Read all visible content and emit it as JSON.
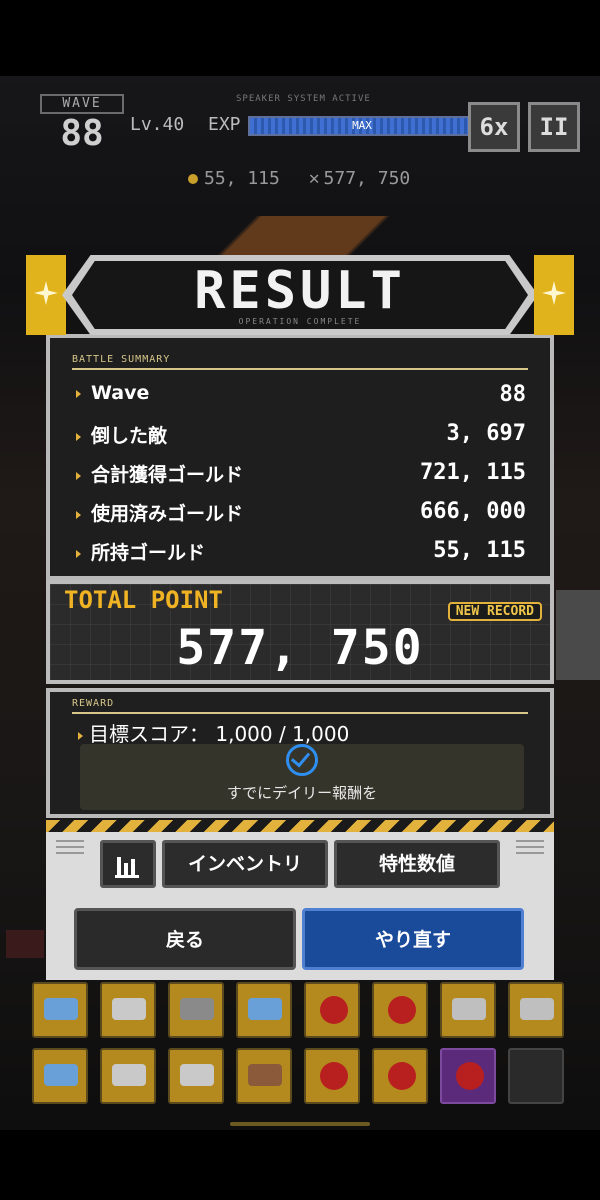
{
  "hud": {
    "wave_tag": "WAVE",
    "wave_number": "88",
    "level": "Lv.40",
    "exp_label": "EXP",
    "exp_max": "MAX",
    "exp_fill": 1.0,
    "system_text": "SPEAKER SYSTEM ACTIVE",
    "speed": "6x",
    "pause": "II",
    "gold": "55, 115",
    "kills": "577, 750"
  },
  "result": {
    "title": "RESULT",
    "subtitle": "OPERATION COMPLETE"
  },
  "summary": {
    "label": "BATTLE SUMMARY",
    "rows": [
      {
        "label": "Wave",
        "value": "88"
      },
      {
        "label": "倒した敵",
        "value": "3, 697"
      },
      {
        "label": "合計獲得ゴールド",
        "value": "721, 115"
      },
      {
        "label": "使用済みゴールド",
        "value": "666, 000"
      },
      {
        "label": "所持ゴールド",
        "value": "55, 115"
      }
    ]
  },
  "total": {
    "label": "TOTAL POINT",
    "badge": "NEW RECORD",
    "value": "577, 750"
  },
  "reward": {
    "label": "REWARD",
    "goal": "目標スコア： 1,000 / 1,000",
    "claimed_text": "すでにデイリー報酬を"
  },
  "tabs": {
    "inventory": "インベントリ",
    "traits": "特性数値"
  },
  "actions": {
    "back": "戻る",
    "retry": "やり直す"
  },
  "colors": {
    "accent_gold": "#e3b23c",
    "retry_blue": "#1a4a9a",
    "check_blue": "#2f8ff0"
  }
}
